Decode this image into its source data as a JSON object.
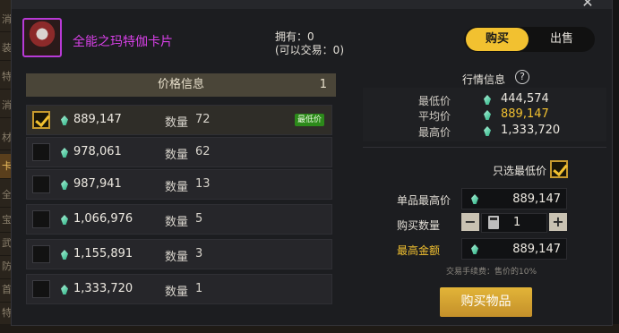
{
  "background": {
    "sidebar_tabs": [
      {
        "label": "消耗"
      },
      {
        "label": "装饰"
      },
      {
        "label": "特殊"
      },
      {
        "label": "消耗"
      },
      {
        "label": "材料"
      },
      {
        "label": "卡片",
        "active": true
      },
      {
        "label": "全"
      },
      {
        "label": "宝"
      },
      {
        "label": "武"
      },
      {
        "label": "防"
      },
      {
        "label": "首"
      },
      {
        "label": "特"
      }
    ]
  },
  "header": {
    "item_name": "全能之玛特伽卡片",
    "owned": "拥有：0",
    "tradable": "(可以交易：0)",
    "toggle": {
      "buy": "购买",
      "sell": "出售"
    }
  },
  "listing": {
    "header_title": "价格信息",
    "page": "1",
    "qty_label": "数量",
    "lowest_badge": "最低价",
    "rows": [
      {
        "price": "889,147",
        "qty": "72",
        "checked": true,
        "lowest": true
      },
      {
        "price": "978,061",
        "qty": "62",
        "checked": false
      },
      {
        "price": "987,941",
        "qty": "13",
        "checked": false
      },
      {
        "price": "1,066,976",
        "qty": "5",
        "checked": false
      },
      {
        "price": "1,155,891",
        "qty": "3",
        "checked": false
      },
      {
        "price": "1,333,720",
        "qty": "1",
        "checked": false
      }
    ]
  },
  "market": {
    "title": "行情信息",
    "help": "?",
    "min_label": "最低价",
    "min_value": "444,574",
    "avg_label": "平均价",
    "avg_value": "889,147",
    "max_label": "最高价",
    "max_value": "1,333,720"
  },
  "purchase": {
    "only_lowest_label": "只选最低价",
    "unit_max_label": "单品最高价",
    "unit_max_value": "889,147",
    "qty_label": "购买数量",
    "qty_value": "1",
    "minus": "−",
    "plus": "+",
    "total_max_label": "最高金额",
    "total_max_value": "889,147",
    "fee_note": "交易手续费：售价的10%",
    "buy_button": "购买物品"
  },
  "colors": {
    "accent_gold": "#f2c130",
    "item_name": "#d640e6",
    "badge_green": "#2c8a1a"
  }
}
